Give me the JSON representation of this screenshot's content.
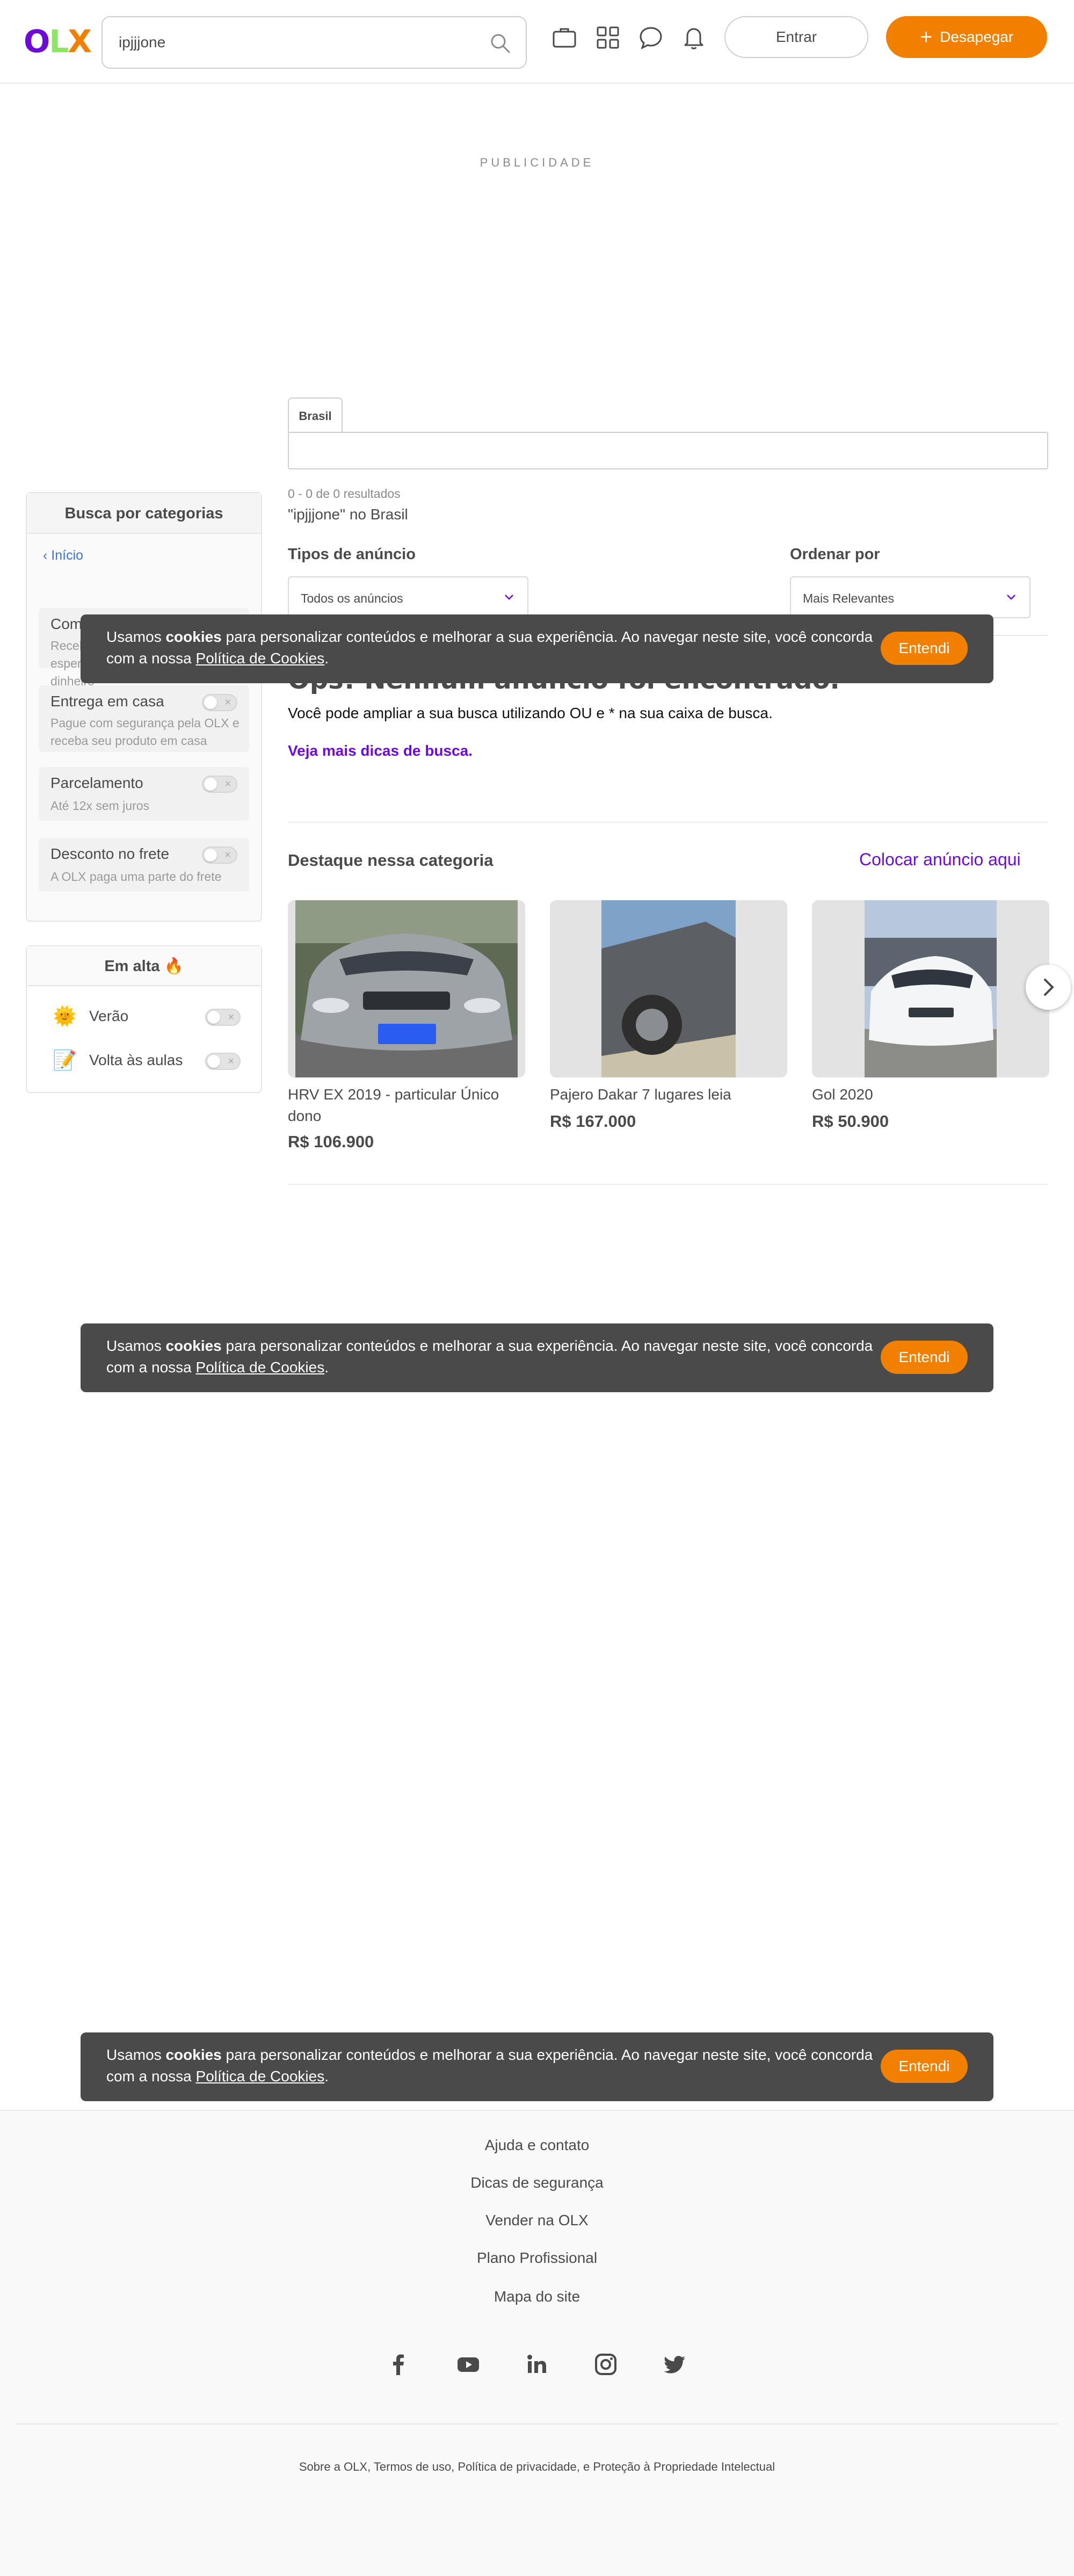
{
  "header": {
    "logo": {
      "o": "O",
      "l": "L",
      "x": "X"
    },
    "search_value": "ipjjjone",
    "entrar": "Entrar",
    "desapegar": "Desapegar",
    "icons": [
      "briefcase-icon",
      "grid-icon",
      "chat-icon",
      "bell-icon"
    ]
  },
  "ad": {
    "label": "PUBLICIDADE"
  },
  "sidebar": {
    "title": "Busca por categorias",
    "back": "Início",
    "filters": [
      {
        "title": "Compra Segura",
        "desc": "Receba o produto que está esperando ou devolvemos o dinheiro"
      },
      {
        "title": "Entrega em casa",
        "desc": "Pague com segurança pela OLX e receba seu produto em casa"
      },
      {
        "title": "Parcelamento",
        "desc": "Até 12x sem juros"
      },
      {
        "title": "Desconto no frete",
        "desc": "A OLX paga uma parte do frete"
      }
    ],
    "trending": {
      "title": "Em alta 🔥",
      "items": [
        {
          "emoji": "🌞",
          "label": "Verão"
        },
        {
          "emoji": "📝",
          "label": "Volta às aulas"
        }
      ]
    }
  },
  "main": {
    "location_tab": "Brasil",
    "results_count": "0 - 0 de 0 resultados",
    "results_query": "\"ipjjjone\" no Brasil",
    "tipos_label": "Tipos de anúncio",
    "tipos_value": "Todos os anúncios",
    "ordenar_label": "Ordenar por",
    "ordenar_value": "Mais Relevantes",
    "empty_title": "Ops! Nenhum anúncio foi encontrado.",
    "empty_desc": "Você pode ampliar a sua busca utilizando OU e * na sua caixa de busca.",
    "tips_link": "Veja mais dicas de busca.",
    "featured_title": "Destaque nessa categoria",
    "featured_link": "Colocar anúncio aqui",
    "cards": [
      {
        "title": "HRV EX 2019 - particular Único dono",
        "price": "R$ 106.900"
      },
      {
        "title": "Pajero Dakar 7 lugares leia",
        "price": "R$ 167.000"
      },
      {
        "title": "Gol 2020",
        "price": "R$ 50.900"
      }
    ]
  },
  "cookie": {
    "pre": "Usamos ",
    "bold": "cookies",
    "mid": " para personalizar conteúdos e melhorar a sua experiência. Ao navegar neste site, você concorda com a nossa ",
    "link": "Política de Cookies",
    "post": ".",
    "button": "Entendi"
  },
  "footer": {
    "links": [
      "Ajuda e contato",
      "Dicas de segurança",
      "Vender na OLX",
      "Plano Profissional",
      "Mapa do site"
    ],
    "social": [
      "facebook-icon",
      "youtube-icon",
      "linkedin-icon",
      "instagram-icon",
      "twitter-icon"
    ],
    "legal": "Sobre a OLX, Termos de uso, Política de privacidade, e Proteção à Propriedade Intelectual"
  },
  "colors": {
    "brand_purple": "#6e0ad6",
    "brand_orange": "#f28000",
    "brand_green": "#8ce563",
    "banner_bg": "#4a4a4a"
  }
}
